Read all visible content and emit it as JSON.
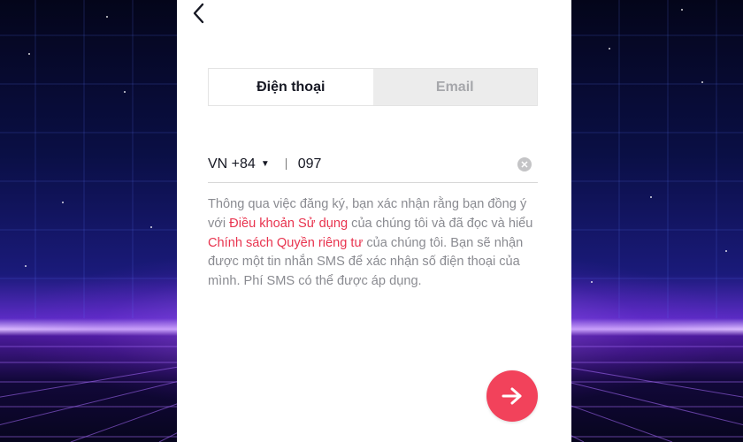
{
  "tabs": [
    {
      "label": "Điện thoại",
      "active": true
    },
    {
      "label": "Email",
      "active": false
    }
  ],
  "phone": {
    "country_code": "VN +84",
    "value": "097",
    "placeholder": ""
  },
  "terms": {
    "part1": "Thông qua việc đăng ký, bạn xác nhận rằng bạn đồng ý với ",
    "link_terms": "Điều khoản Sử dụng",
    "part2": " của chúng tôi và đã đọc và hiểu ",
    "link_privacy": "Chính sách Quyền riêng tư",
    "part3": " của chúng tôi. Bạn sẽ nhận được một tin nhắn SMS để xác nhận số điện thoại của mình. Phí SMS có thể được áp dụng."
  },
  "icons": {
    "back": "chevron-left-icon",
    "dropdown": "caret-down-icon",
    "clear": "clear-icon",
    "next": "arrow-right-icon"
  },
  "colors": {
    "accent": "#f2425b",
    "link": "#e8344f",
    "inactive_tab_bg": "#ececec"
  }
}
